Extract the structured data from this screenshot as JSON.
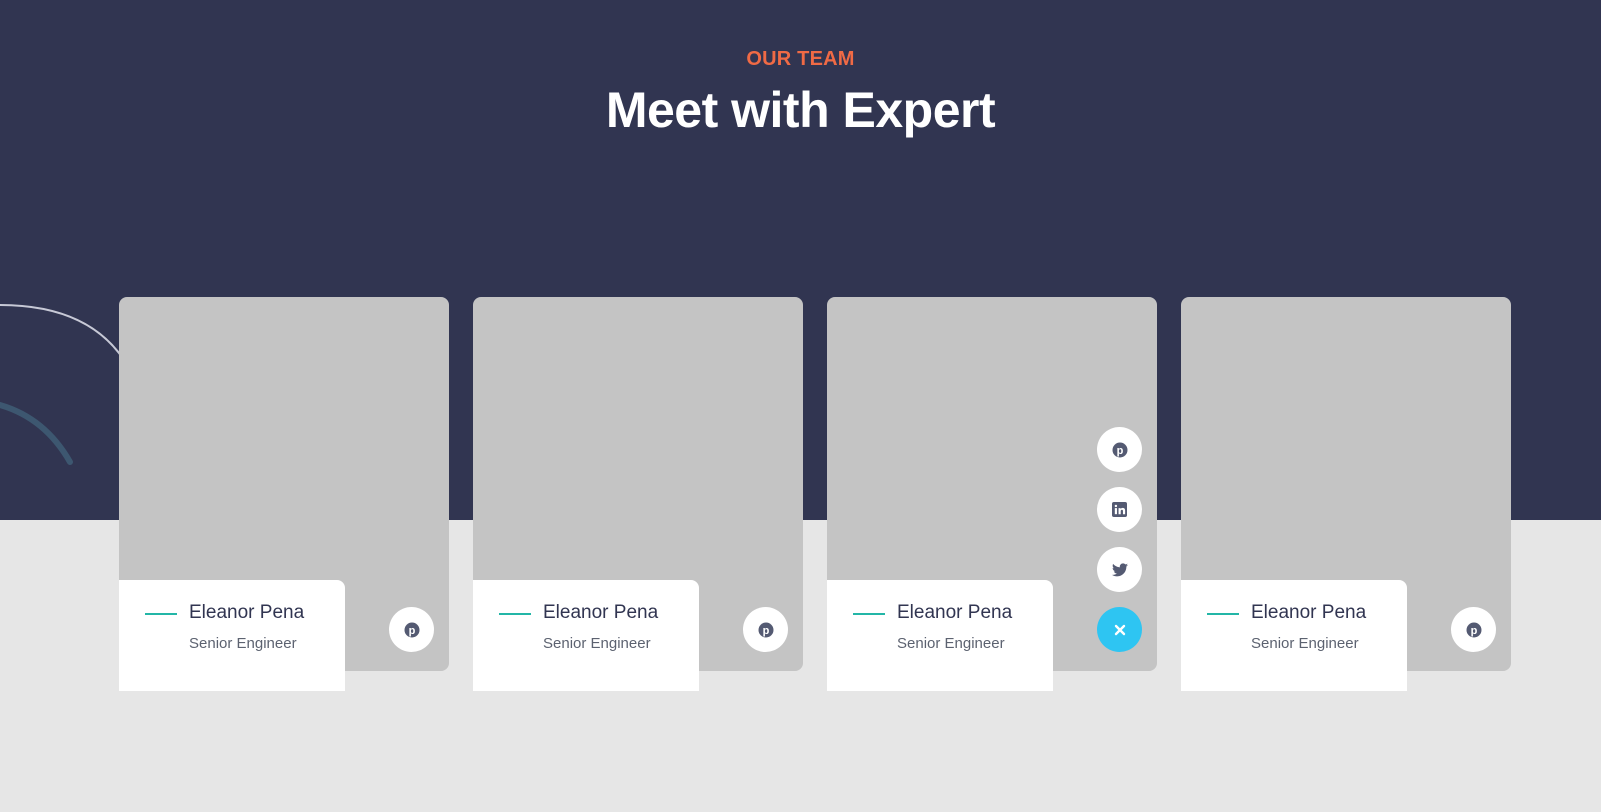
{
  "header": {
    "eyebrow": "OUR TEAM",
    "title": "Meet with Expert"
  },
  "colors": {
    "hero_bg": "#313551",
    "page_bg": "#e6e6e6",
    "accent_orange": "#f06a45",
    "accent_teal": "#23b6a7",
    "accent_blue": "#2ec5f2",
    "photo_placeholder": "#c4c4c4"
  },
  "team": [
    {
      "name": "Eleanor Pena",
      "role": "Senior Engineer",
      "social_state": "collapsed",
      "icon": "pinterest-icon"
    },
    {
      "name": "Eleanor Pena",
      "role": "Senior Engineer",
      "social_state": "collapsed",
      "icon": "pinterest-icon"
    },
    {
      "name": "Eleanor Pena",
      "role": "Senior Engineer",
      "social_state": "expanded",
      "icons": [
        "pinterest-icon",
        "linkedin-icon",
        "twitter-icon",
        "close-icon"
      ]
    },
    {
      "name": "Eleanor Pena",
      "role": "Senior Engineer",
      "social_state": "collapsed",
      "icon": "pinterest-icon"
    }
  ]
}
